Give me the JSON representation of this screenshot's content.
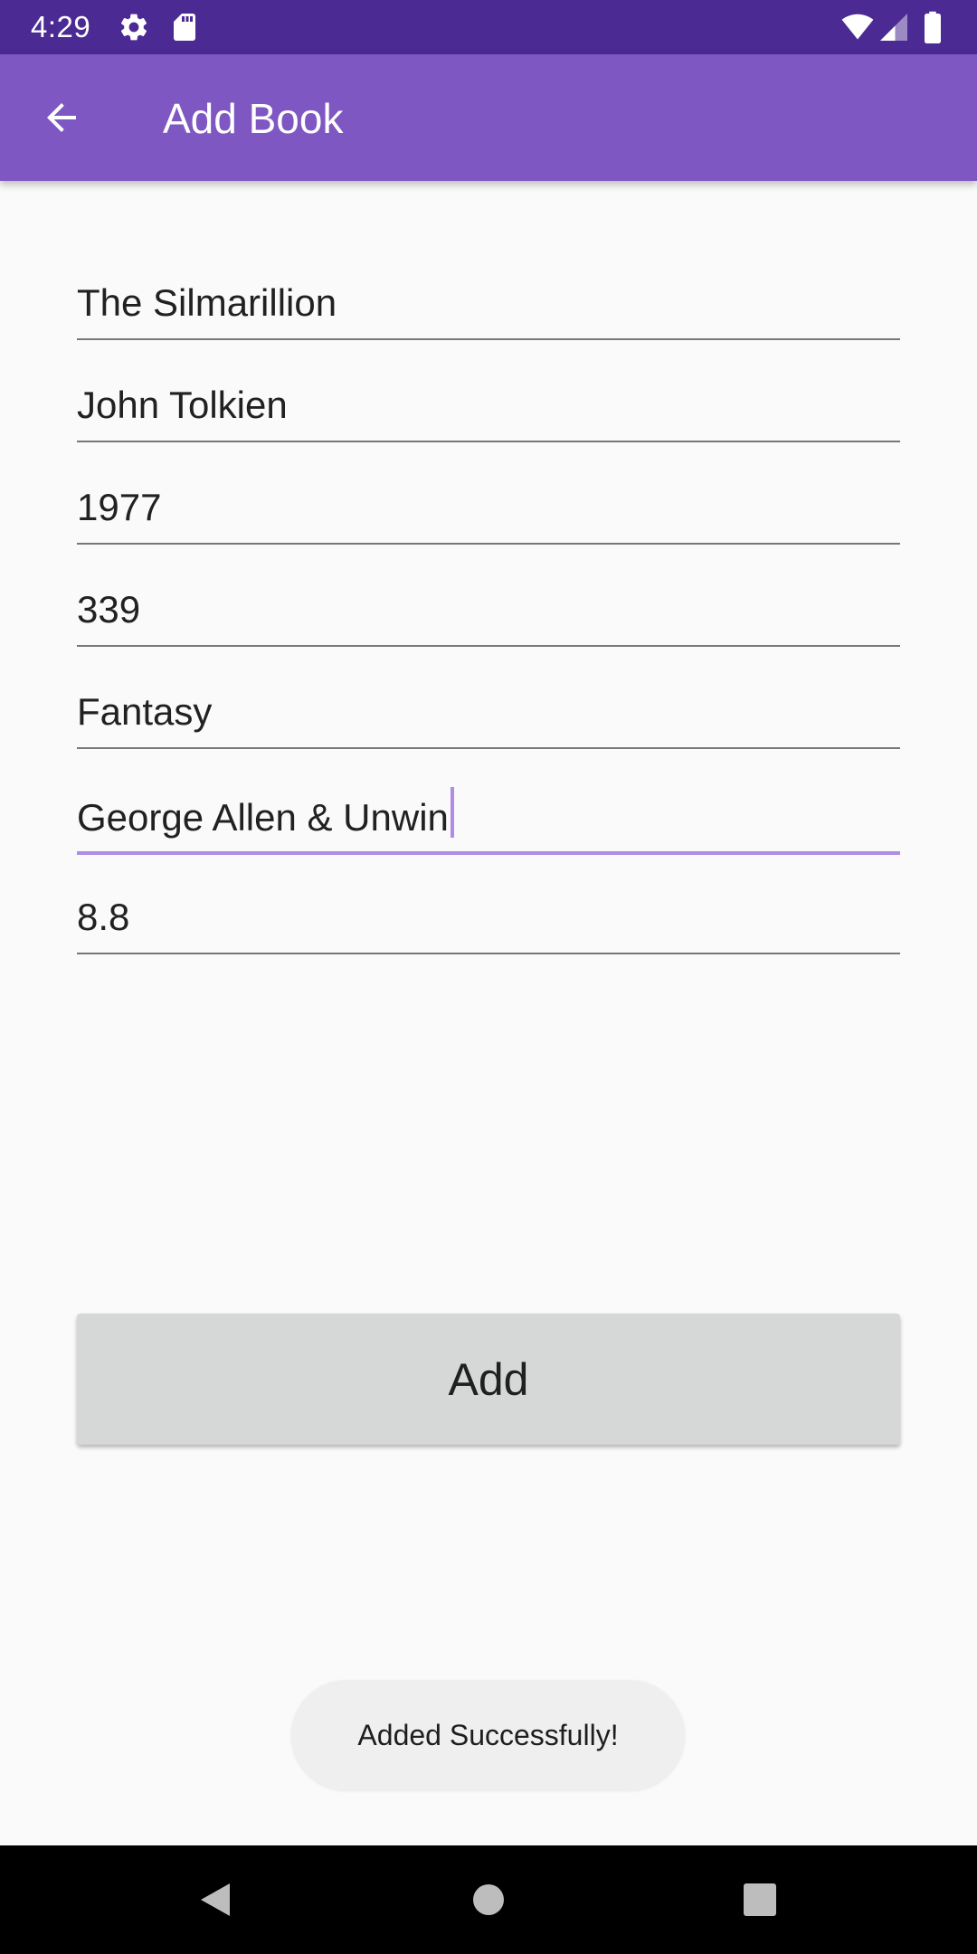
{
  "status_bar": {
    "time": "4:29",
    "left_icons": [
      "gear-icon",
      "sd-card-icon"
    ],
    "right_icons": [
      "wifi-icon",
      "cell-signal-icon",
      "battery-icon"
    ],
    "background": "#4B2A93"
  },
  "app_bar": {
    "title": "Add Book",
    "back_icon": "arrow-back-icon",
    "background": "#7E57C2"
  },
  "form": {
    "fields": [
      {
        "value": "The Silmarillion"
      },
      {
        "value": "John Tolkien"
      },
      {
        "value": "1977"
      },
      {
        "value": "339"
      },
      {
        "value": "Fantasy"
      },
      {
        "value": "George Allen & Unwin",
        "focused": true
      },
      {
        "value": "8.8"
      }
    ],
    "focus_color": "#B08CE6"
  },
  "add_button": {
    "label": "Add"
  },
  "toast": {
    "message": "Added Successfully!"
  },
  "nav_bar": {
    "buttons": [
      "back-triangle-icon",
      "home-circle-icon",
      "recents-square-icon"
    ]
  }
}
